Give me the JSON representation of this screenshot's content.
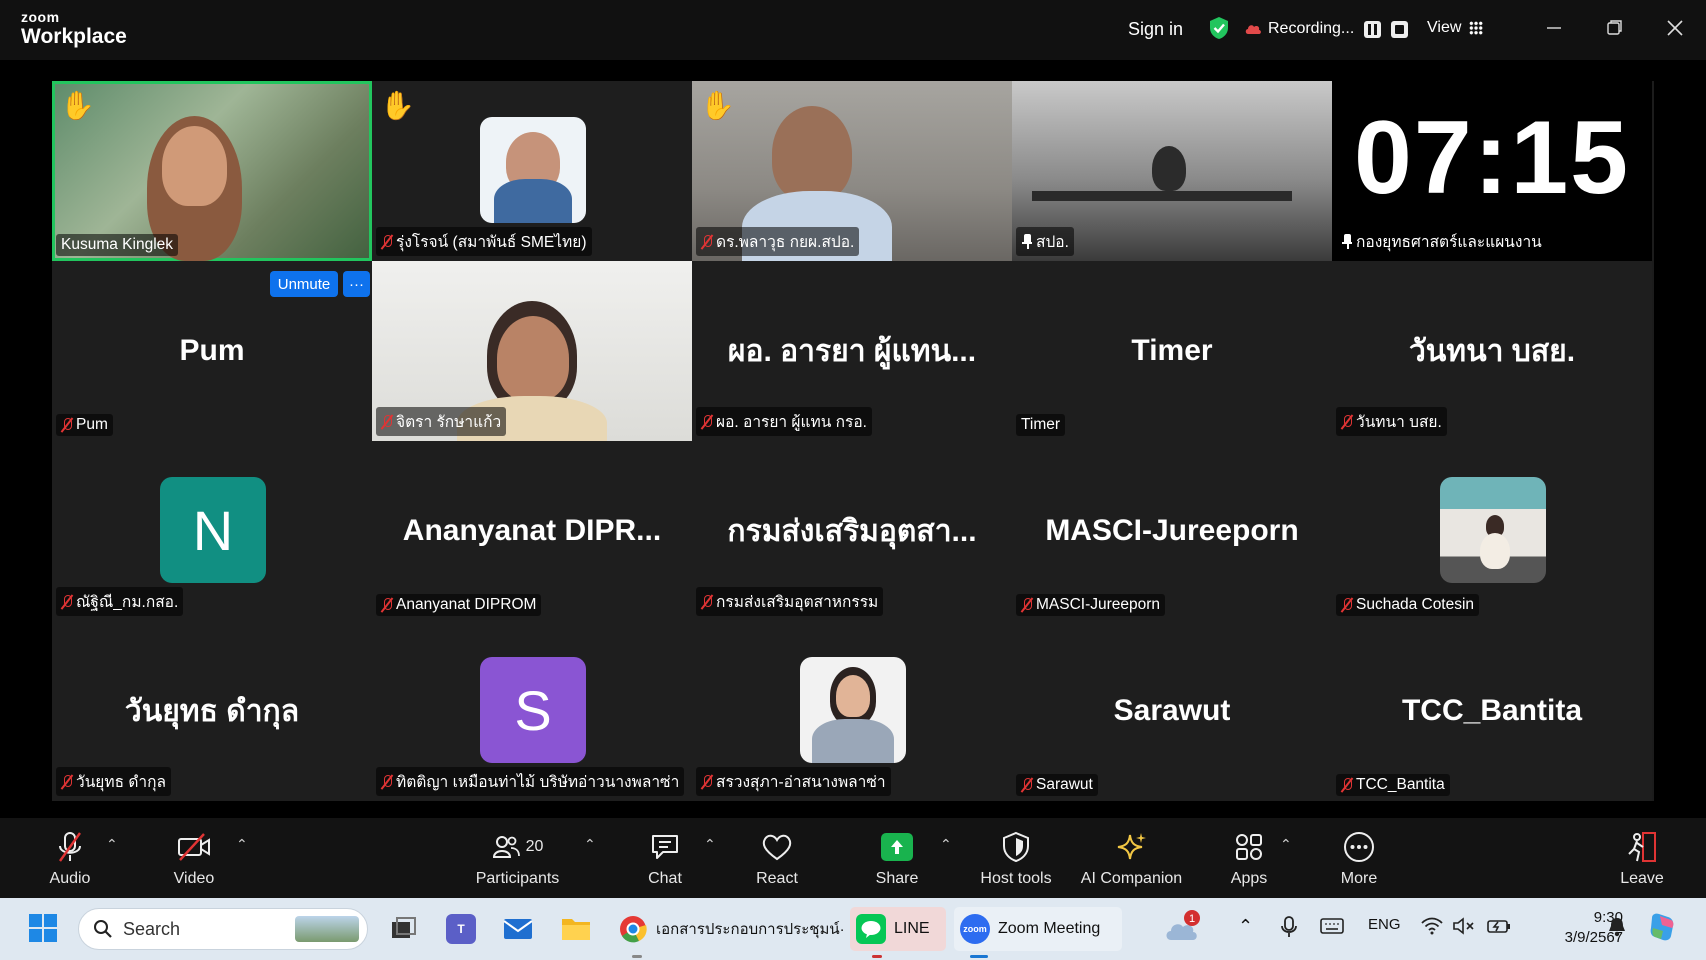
{
  "titlebar": {
    "logo_line1": "zoom",
    "logo_line2": "Workplace",
    "sign_in": "Sign in",
    "recording": "Recording...",
    "view": "View"
  },
  "tiles": [
    {
      "name": "Kusuma Kinglek",
      "hand": true,
      "type": "video",
      "muted": false,
      "active": true
    },
    {
      "name": "รุ่งโรจน์ (สมาพันธ์ SMEไทย)",
      "hand": true,
      "type": "photo",
      "muted": true
    },
    {
      "name": "ดร.พลาวุธ  กยผ.สปอ.",
      "hand": true,
      "type": "video",
      "muted": true
    },
    {
      "name": "สปอ.",
      "type": "video",
      "pinned": true
    },
    {
      "name": "กองยุทธศาสตร์และแผนงาน",
      "type": "clock",
      "clock": "07:15",
      "pinned": true
    },
    {
      "name": "Pum",
      "big": "Pum",
      "muted": true
    },
    {
      "name": "จิตรา รักษาแก้ว",
      "type": "video",
      "muted": true
    },
    {
      "name": "ผอ. อารยา ผู้แทน กรอ.",
      "big": "ผอ. อารยา ผู้แทน...",
      "muted": true
    },
    {
      "name": "Timer",
      "big": "Timer",
      "muted": false
    },
    {
      "name": "วันทนา บสย.",
      "big": "วันทนา บสย.",
      "muted": true
    },
    {
      "name": "ณัฐิณี_กม.กสอ.",
      "avatar": "N",
      "muted": true
    },
    {
      "name": "Ananyanat DIPROM",
      "big": "Ananyanat  DIPR...",
      "muted": true
    },
    {
      "name": "กรมส่งเสริมอุตสาหกรรม",
      "big": "กรมส่งเสริมอุตสา...",
      "muted": true
    },
    {
      "name": "MASCI-Jureeporn",
      "big": "MASCI-Jureeporn",
      "muted": true
    },
    {
      "name": "Suchada Cotesin",
      "type": "photo",
      "muted": true
    },
    {
      "name": "วันยุทธ  ดำกุล",
      "big": "วันยุทธ  ดำกุล",
      "muted": true
    },
    {
      "name": "ทิตติญา เหมือนท่าไม้ บริษัทอ่าวนางพลาซ่า",
      "avatar": "S",
      "muted": true
    },
    {
      "name": "สรวงสุภา-อ่าสนางพลาซ่า",
      "type": "photo",
      "muted": true
    },
    {
      "name": "Sarawut",
      "big": "Sarawut",
      "muted": true
    },
    {
      "name": "TCC_Bantita",
      "big": "TCC_Bantita",
      "muted": true
    }
  ],
  "self_controls": {
    "unmute": "Unmute",
    "more": "···"
  },
  "colors": {
    "avatar_n": "#118f82",
    "avatar_s": "#8a55d3",
    "active_border": "#22c55e",
    "unmute_bg": "#0e72ed"
  },
  "toolbar": {
    "audio": "Audio",
    "video": "Video",
    "participants": "Participants",
    "participants_count": "20",
    "chat": "Chat",
    "react": "React",
    "share": "Share",
    "host_tools": "Host tools",
    "ai_companion": "AI Companion",
    "apps": "Apps",
    "more": "More",
    "leave": "Leave"
  },
  "taskbar": {
    "search_placeholder": "Search",
    "doc_app": "เอกสารประกอบการประชุมน์·",
    "line_app": "LINE",
    "zoom_app": "Zoom Meeting",
    "zoom_icon_text": "zoom",
    "lang": "ENG",
    "time": "9:30",
    "date": "3/9/2567",
    "badge": "1"
  }
}
